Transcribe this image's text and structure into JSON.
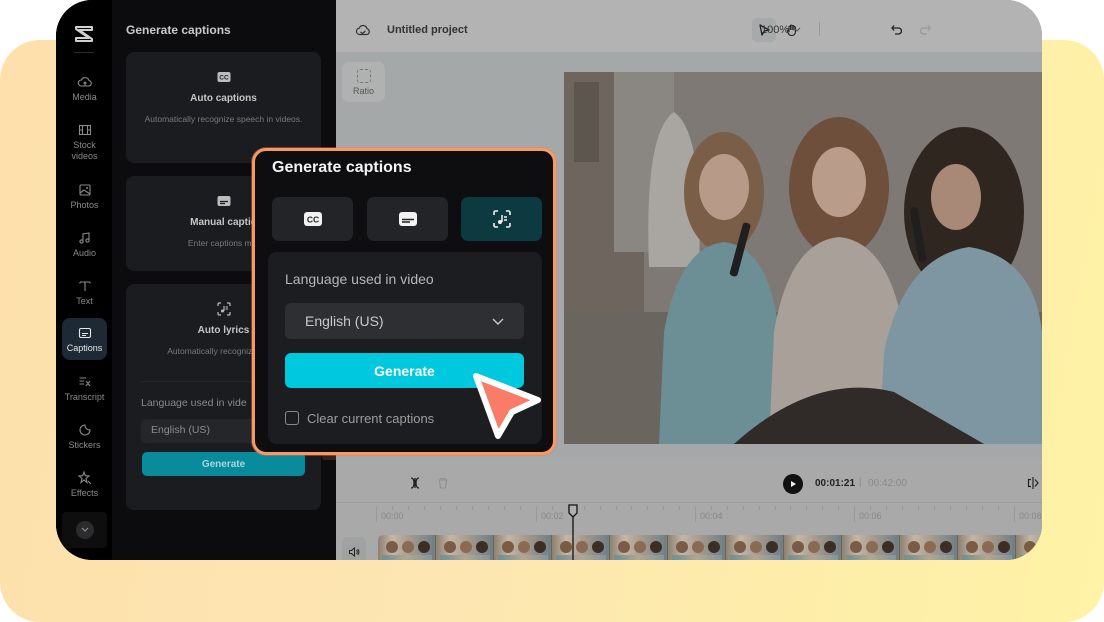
{
  "app": {
    "project_title": "Untitled project",
    "zoom_level": "100%",
    "colors": {
      "accent": "#00c8de",
      "popup_border": "#f79a62",
      "cursor": "#f87c68",
      "active_mode": "#0d3940"
    }
  },
  "rail": {
    "logo": "capcut-logo-icon",
    "items": [
      {
        "label": "Media",
        "icon": "cloud-upload-icon",
        "active": false
      },
      {
        "label": "Stock videos",
        "icon": "film-icon",
        "active": false
      },
      {
        "label": "Photos",
        "icon": "image-icon",
        "active": false
      },
      {
        "label": "Audio",
        "icon": "music-note-icon",
        "active": false
      },
      {
        "label": "Text",
        "icon": "text-icon",
        "active": false
      },
      {
        "label": "Captions",
        "icon": "captions-icon",
        "active": true
      },
      {
        "label": "Transcript",
        "icon": "transcript-icon",
        "active": false
      },
      {
        "label": "Stickers",
        "icon": "sticker-icon",
        "active": false
      },
      {
        "label": "Effects",
        "icon": "sparkle-icon",
        "active": false
      }
    ],
    "more_icon": "chevron-down-icon"
  },
  "panel": {
    "title": "Generate captions",
    "cards": [
      {
        "title": "Auto captions",
        "description": "Automatically recognize speech in videos.",
        "icon": "cc-icon"
      },
      {
        "title": "Manual captio",
        "description": "Enter captions mar",
        "icon": "subtitle-icon"
      },
      {
        "title": "Auto lyrics",
        "description": "Automatically recogniz songs.",
        "icon": "lyrics-icon"
      }
    ],
    "language_label": "Language used in vide",
    "language_value": "English (US)",
    "generate_label": "Generate"
  },
  "canvas": {
    "ratio_label": "Ratio"
  },
  "timeline": {
    "current_time": "00:01:21",
    "separator": "|",
    "total_time": "00:42:00",
    "ruler_labels": [
      "00:00",
      "00:02",
      "00:04",
      "00:06",
      "00:08"
    ]
  },
  "popup": {
    "title": "Generate captions",
    "modes": [
      {
        "name": "auto-captions",
        "icon": "cc-icon",
        "active": false
      },
      {
        "name": "manual-captions",
        "icon": "subtitle-icon",
        "active": false
      },
      {
        "name": "auto-lyrics",
        "icon": "lyrics-icon",
        "active": true
      }
    ],
    "language_label": "Language used in video",
    "language_value": "English (US)",
    "generate_label": "Generate",
    "clear_label": "Clear current captions",
    "clear_checked": false
  }
}
